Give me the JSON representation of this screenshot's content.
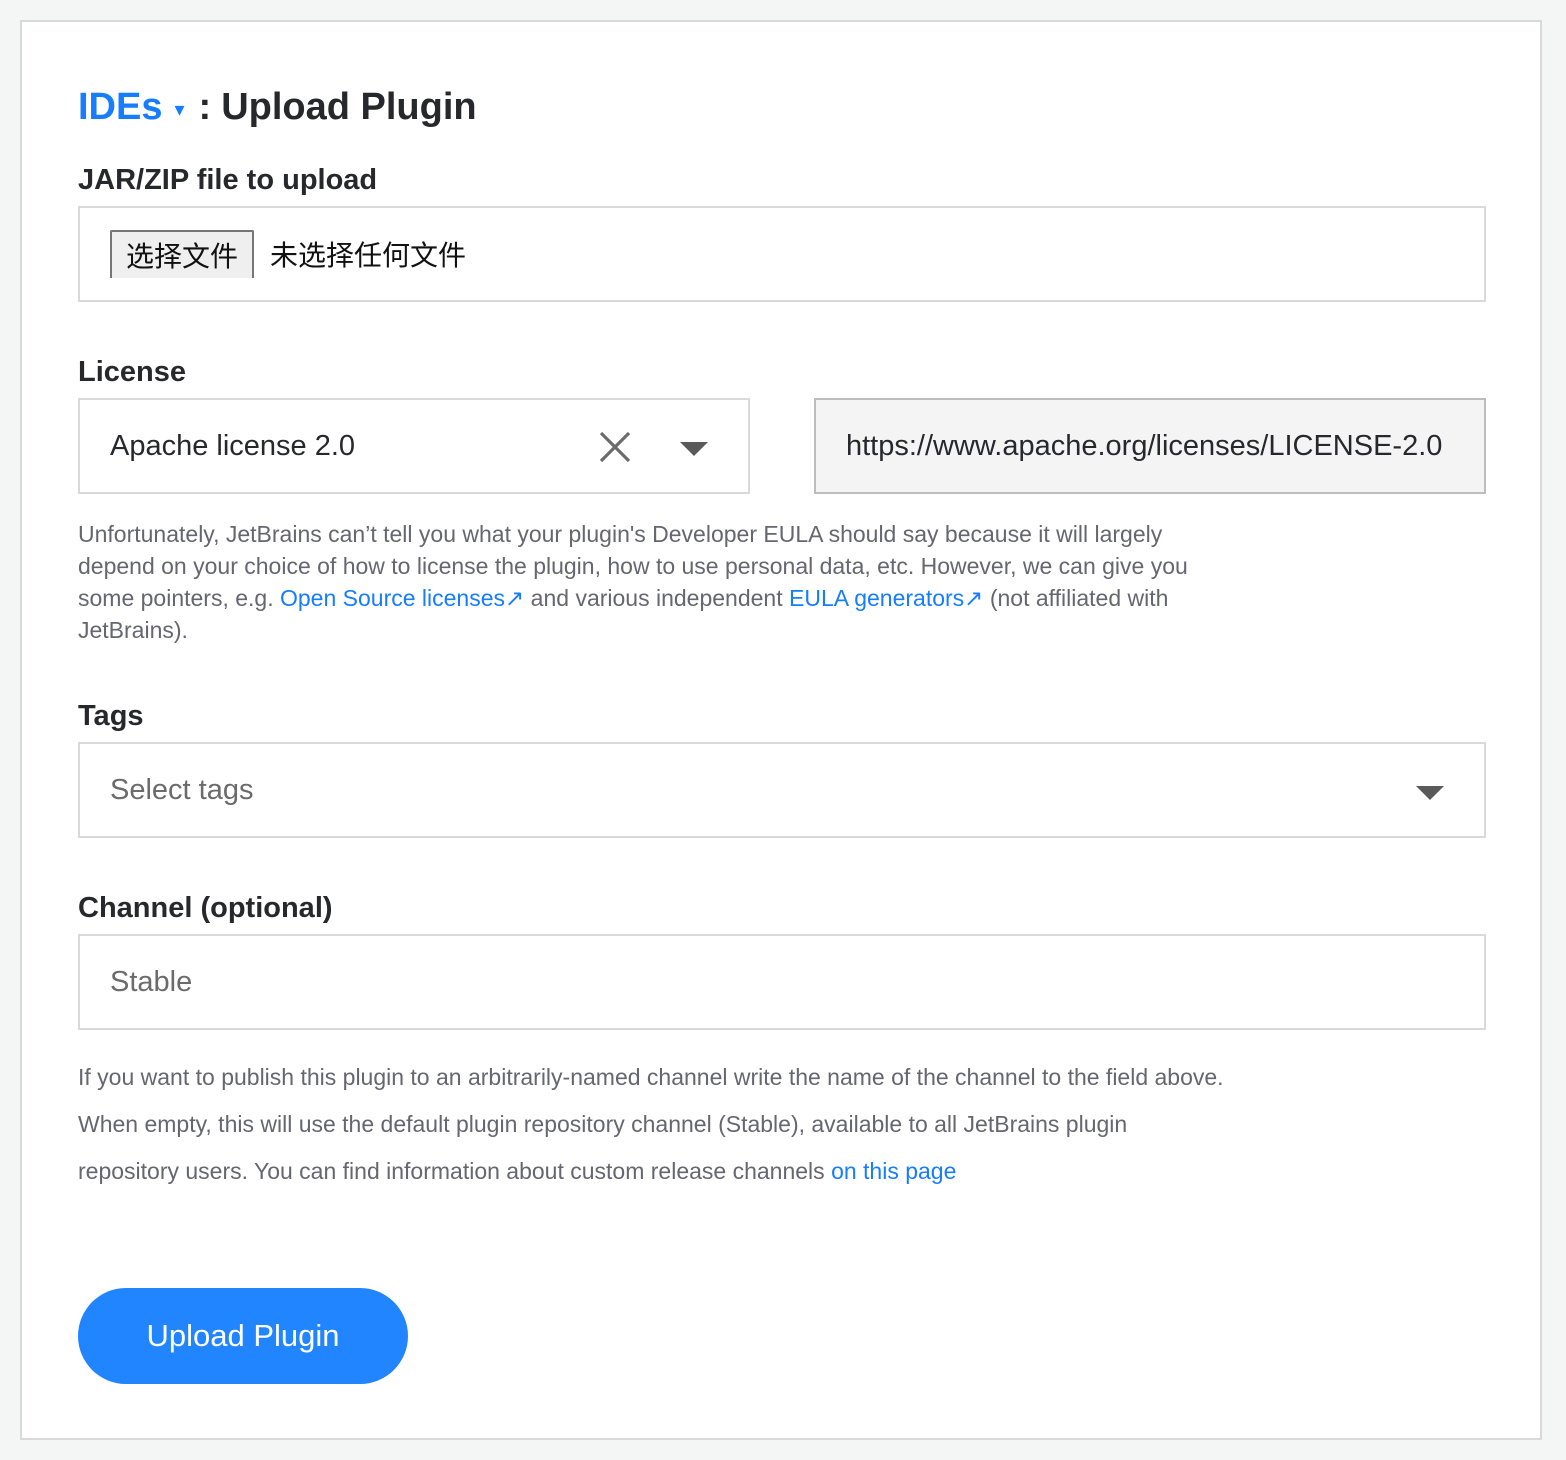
{
  "header": {
    "breadcrumb": "IDEs",
    "breadcrumb_caret": "▾",
    "separator": ":",
    "title": "Upload Plugin"
  },
  "file_upload": {
    "label": "JAR/ZIP file to upload",
    "button_label": "选择文件",
    "status": "未选择任何文件"
  },
  "license": {
    "label": "License",
    "selected": "Apache license 2.0",
    "url": "https://www.apache.org/licenses/LICENSE-2.0",
    "help_1": "Unfortunately, JetBrains can’t tell you what your plugin's Developer EULA should say because it will largely depend on your choice of how to license the plugin, how to use personal data, etc. However, we can give you some pointers, e.g. ",
    "link_1": "Open Source licenses",
    "help_2": " and various independent ",
    "link_2": "EULA generators",
    "help_3": " (not affiliated with JetBrains).",
    "external_arrow": "↗"
  },
  "tags": {
    "label": "Tags",
    "placeholder": "Select tags"
  },
  "channel": {
    "label": "Channel (optional)",
    "placeholder": "Stable",
    "help_1": "If you want to publish this plugin to an arbitrarily-named channel write the name of the channel to the field above. When empty, this will use the default plugin repository channel (Stable), available to all JetBrains plugin repository users. You can find information about custom release channels ",
    "link": "on this page"
  },
  "submit": {
    "label": "Upload Plugin"
  },
  "colors": {
    "accent": "#167dff",
    "button": "#2185ff"
  }
}
